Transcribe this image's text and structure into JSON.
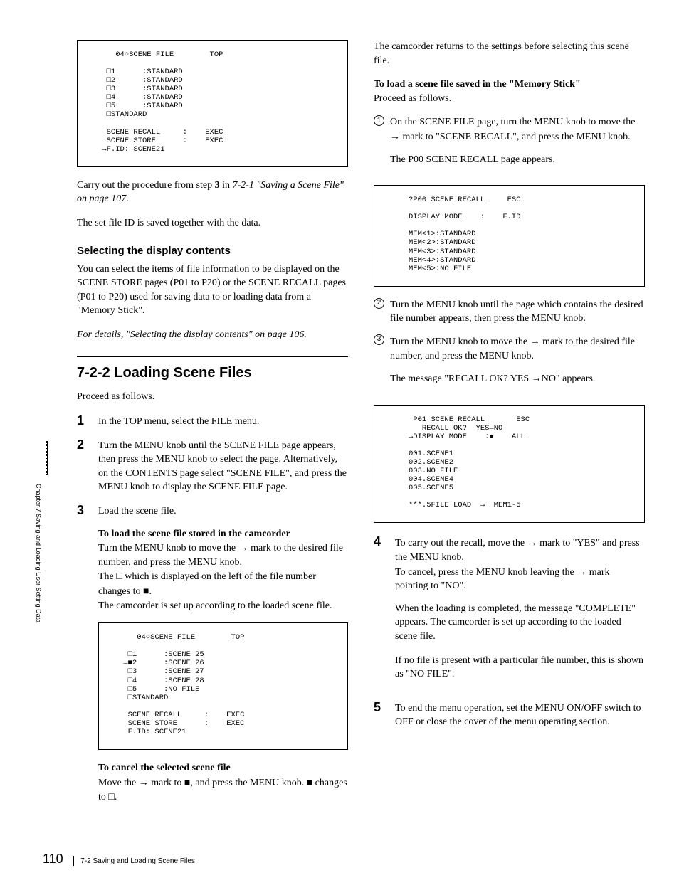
{
  "sidebar": {
    "text": "Chapter 7   Saving and Loading User Setting Data"
  },
  "left": {
    "screen1": "    04○SCENE FILE        TOP\n\n  □1      :STANDARD\n  □2      :STANDARD\n  □3      :STANDARD\n  □4      :STANDARD\n  □5      :STANDARD\n  □STANDARD\n\n  SCENE RECALL     :    EXEC\n  SCENE STORE      :    EXEC\n →F.ID: SCENE21",
    "p1a": "Carry out the procedure from step ",
    "p1b": " in ",
    "p1c": "7-2-1 \"Saving a Scene File\" on page 107",
    "p1d": ".",
    "p1bold": "3",
    "p2": "The set file ID is saved together with the data.",
    "h3a": "Selecting the display contents",
    "p3": "You can select the items of file information to be displayed on the SCENE STORE pages (P01 to P20) or the SCENE RECALL pages (P01 to P20) used for saving data to or loading data from a \"Memory Stick\".",
    "p4": "For details, \"Selecting the display contents\" on page 106.",
    "h2": "7-2-2  Loading Scene Files",
    "p5": "Proceed as follows.",
    "step1": "In the TOP menu, select the FILE menu.",
    "step2": "Turn the MENU knob until the SCENE FILE page appears, then press the MENU knob to select the page. Alternatively, on the CONTENTS page select \"SCENE FILE\", and press the MENU knob to display the SCENE FILE page.",
    "step3": "Load the scene file.",
    "sub1title": "To load the scene file stored in the camcorder",
    "sub1a": "Turn the MENU knob to move the ",
    "sub1b": " mark to the desired file number, and press the MENU knob.",
    "sub1c": "The ",
    "sub1d": " which is displayed on the left of the file number changes to ",
    "sub1e": ".",
    "sub1f": "The camcorder is set up according to the loaded scene file.",
    "screen2": "    04○SCENE FILE        TOP\n\n  □1      :SCENE 25\n →■2      :SCENE 26\n  □3      :SCENE 27\n  □4      :SCENE 28\n  □5      :NO FILE\n  □STANDARD\n\n  SCENE RECALL     :    EXEC\n  SCENE STORE      :    EXEC\n  F.ID: SCENE21",
    "sub2title": "To cancel the selected scene file",
    "sub2a": "Move the ",
    "sub2b": " mark to ",
    "sub2c": ", and press the MENU knob. ",
    "sub2d": " changes to ",
    "sub2e": "."
  },
  "right": {
    "p1": "The camcorder returns to the settings before selecting this scene file.",
    "p2bold": "To load a scene file saved in the \"Memory Stick\"",
    "p2": "Proceed as follows.",
    "c1a": "On the SCENE FILE page, turn the MENU knob to move the ",
    "c1b": " mark to \"SCENE RECALL\", and press the MENU knob.",
    "c1c": "The P00 SCENE RECALL page appears.",
    "screen3": "?P00 SCENE RECALL     ESC\n\nDISPLAY MODE    :    F.ID\n\nMEM<1>:STANDARD\nMEM<2>:STANDARD\nMEM<3>:STANDARD\nMEM<4>:STANDARD\nMEM<5>:NO FILE",
    "c2": "Turn the MENU knob until the page which contains the desired file number appears, then press the MENU knob.",
    "c3a": "Turn the MENU knob to move the ",
    "c3b": " mark to the desired file number, and press the MENU knob.",
    "c3c": "The message \"RECALL OK? YES ",
    "c3d": "NO\" appears.",
    "screen4": " P01 SCENE RECALL       ESC\n   RECALL OK?  YES→NO\n→DISPLAY MODE    :●    ALL\n\n001.SCENE1\n002.SCENE2\n003.NO FILE\n004.SCENE4\n005.SCENE5\n\n***.5FILE LOAD  →  MEM1-5",
    "step4a": "To carry out the recall, move the ",
    "step4b": " mark to \"YES\" and press the MENU knob.",
    "step4c": "To cancel, press the MENU knob leaving the ",
    "step4d": " mark pointing to  \"NO\".",
    "step4e": "When the loading is completed, the message \"COMPLETE\" appears. The camcorder is set up according to the loaded scene file.",
    "step4f": "If no file is present with a particular file number, this is shown as \"NO FILE\".",
    "step5": "To end the menu operation, set the MENU ON/OFF switch to OFF or close the cover of the menu operating section."
  },
  "footer": {
    "pagenum": "110",
    "section": "7-2 Saving and Loading Scene Files"
  },
  "glyphs": {
    "arrow": "→",
    "rarrowthick": "➔",
    "square_open": "□",
    "square_filled": "■"
  }
}
